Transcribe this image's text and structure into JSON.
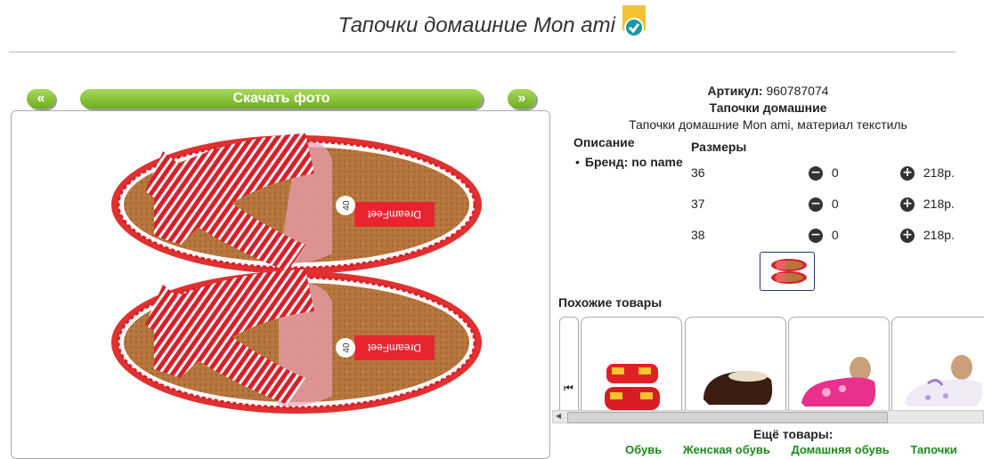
{
  "page": {
    "title": "Тапочки домашние Mon ami"
  },
  "gallery": {
    "prev_label": "«",
    "download_label": "Скачать фото",
    "next_label": "»",
    "size_tag": "40",
    "brand_tag": "DreamFeet"
  },
  "product": {
    "article_label": "Артикул:",
    "article_value": "960787074",
    "category": "Тапочки домашние",
    "subtitle": "Тапочки домашние Mon ami, материал текстиль",
    "description_heading": "Описание",
    "brand_line": "Бренд: no name",
    "sizes_heading": "Размеры",
    "sizes": [
      {
        "size": "36",
        "qty": "0",
        "price": "218р."
      },
      {
        "size": "37",
        "qty": "0",
        "price": "218р."
      },
      {
        "size": "38",
        "qty": "0",
        "price": "218р."
      }
    ]
  },
  "similar": {
    "heading": "Похожие товары",
    "items": [
      "red-slippers",
      "brown-slippers",
      "pink-slippers",
      "white-slippers"
    ]
  },
  "more": {
    "heading": "Ещё товары:",
    "links": [
      "Обувь",
      "Женская обувь",
      "Домашняя обувь",
      "Тапочки"
    ]
  },
  "colors": {
    "accent_green": "#6fae1c",
    "link_green": "#1a8a1a",
    "slipper_red": "#d8202a",
    "cork": "#b5753c"
  }
}
